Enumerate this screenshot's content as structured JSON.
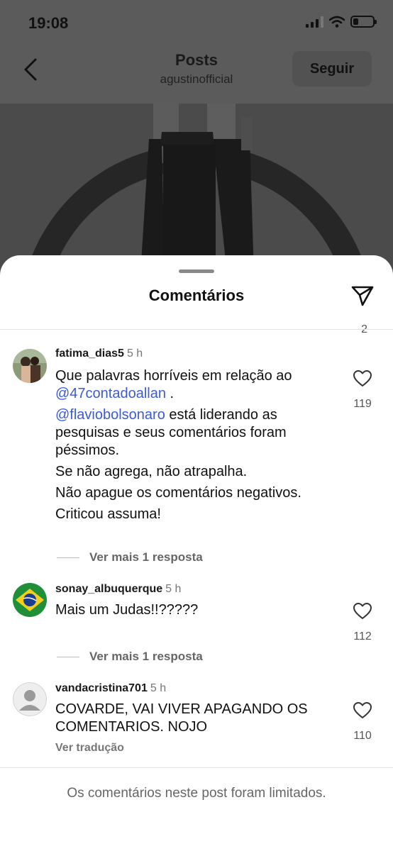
{
  "status_bar": {
    "time": "19:08"
  },
  "nav": {
    "title": "Posts",
    "subtitle": "agustinofficial",
    "follow_label": "Seguir"
  },
  "sheet": {
    "title": "Comentários",
    "partial_like_count": "2",
    "comments": [
      {
        "username": "fatima_dias5",
        "time": "5 h",
        "likes": "119",
        "line1_text": "Que palavras horríveis em relação ao",
        "line1_mention": "@47contadoallan",
        "line1_tail": " .",
        "mention2": "@flaviobolsonaro",
        "line2_text": " está liderando as pesquisas e seus comentários foram péssimos.",
        "line3": "Se não agrega, não atrapalha.",
        "line4": "Não apague os comentários negativos.",
        "line5": "Criticou assuma!",
        "replies": "Ver mais 1 resposta"
      },
      {
        "username": "sonay_albuquerque",
        "time": "5 h",
        "likes": "112",
        "text": "Mais um Judas!!?????",
        "replies": "Ver mais 1 resposta"
      },
      {
        "username": "vandacristina701",
        "time": "5 h",
        "likes": "110",
        "text": "COVARDE,  VAI VIVER APAGANDO OS COMENTARIOS.  NOJO",
        "translate": "Ver tradução"
      }
    ],
    "footer": "Os comentários neste post foram limitados."
  },
  "colors": {
    "mention": "#3b5bd6",
    "overlay": "#5b5b5b"
  }
}
